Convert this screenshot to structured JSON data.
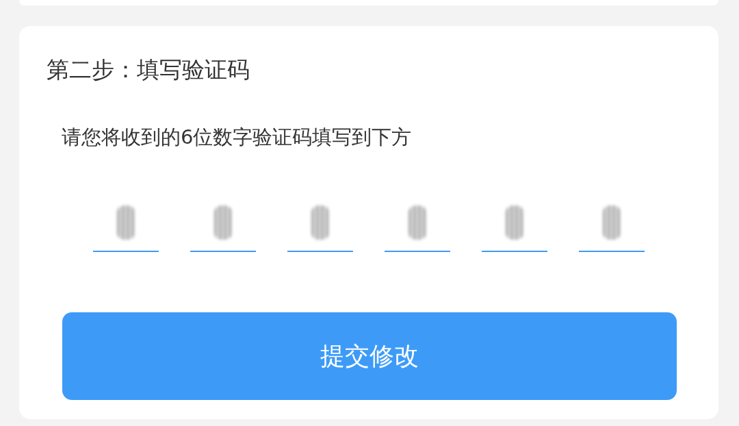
{
  "step_card": {
    "title": "第二步：填写验证码",
    "instruction": "请您将收到的6位数字验证码填写到下方",
    "code_fields": [
      {
        "filled": true
      },
      {
        "filled": true
      },
      {
        "filled": true
      },
      {
        "filled": true
      },
      {
        "filled": true
      },
      {
        "filled": true
      }
    ],
    "submit_button": "提交修改"
  }
}
